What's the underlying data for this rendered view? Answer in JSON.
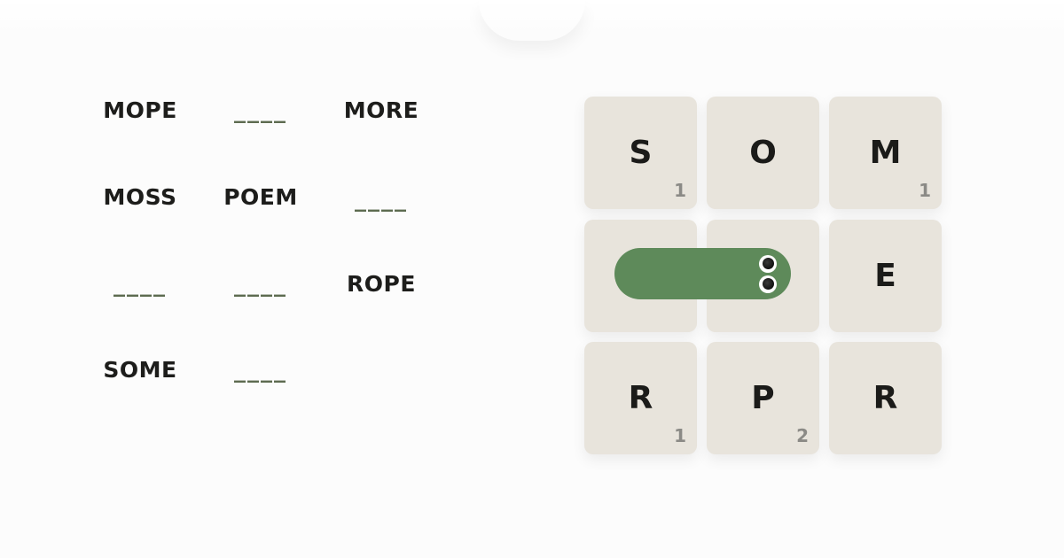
{
  "words": {
    "r0": [
      "MOPE",
      "____",
      "MORE"
    ],
    "r1": [
      "MOSS",
      "POEM",
      "____"
    ],
    "r2": [
      "____",
      "____",
      "ROPE"
    ],
    "r3": [
      "SOME",
      "____"
    ]
  },
  "grid": {
    "tiles": [
      {
        "letter": "S",
        "count": "1"
      },
      {
        "letter": "O",
        "count": ""
      },
      {
        "letter": "M",
        "count": "1"
      },
      {
        "letter": "",
        "count": ""
      },
      {
        "letter": "",
        "count": ""
      },
      {
        "letter": "E",
        "count": ""
      },
      {
        "letter": "R",
        "count": "1"
      },
      {
        "letter": "P",
        "count": "2"
      },
      {
        "letter": "R",
        "count": ""
      }
    ]
  },
  "colors": {
    "tile_bg": "#e8e4dc",
    "worm": "#5e8a5a",
    "blank_dash": "#5d6b50",
    "text": "#1d1d1b"
  },
  "icons": {
    "worm": "worm-cursor-icon"
  }
}
